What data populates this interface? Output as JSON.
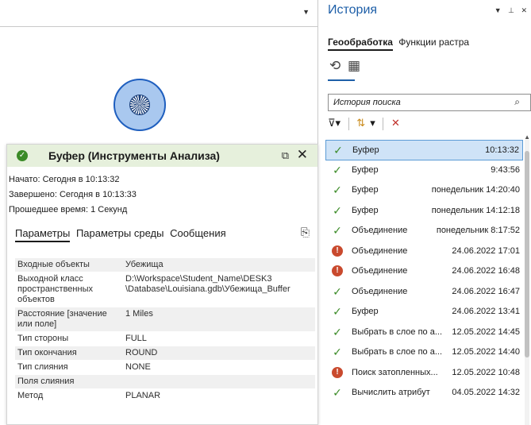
{
  "pane": {
    "title": "История",
    "tabs": [
      "Геообработка",
      "Функции растра"
    ],
    "search_placeholder": "История поиска",
    "history": [
      {
        "name": "Буфер",
        "time": "10:13:32",
        "status": "ok",
        "selected": true
      },
      {
        "name": "Буфер",
        "time": "9:43:56",
        "status": "ok"
      },
      {
        "name": "Буфер",
        "time": "понедельник 14:20:40",
        "status": "ok"
      },
      {
        "name": "Буфер",
        "time": "понедельник 14:12:18",
        "status": "ok"
      },
      {
        "name": "Объединение",
        "time": "понедельник 8:17:52",
        "status": "ok"
      },
      {
        "name": "Объединение",
        "time": "24.06.2022 17:01",
        "status": "error"
      },
      {
        "name": "Объединение",
        "time": "24.06.2022 16:48",
        "status": "error"
      },
      {
        "name": "Объединение",
        "time": "24.06.2022 16:47",
        "status": "ok"
      },
      {
        "name": "Буфер",
        "time": "24.06.2022 13:41",
        "status": "ok"
      },
      {
        "name": "Выбрать в слое по а...",
        "time": "12.05.2022 14:45",
        "status": "ok"
      },
      {
        "name": "Выбрать в слое по а...",
        "time": "12.05.2022 14:40",
        "status": "ok"
      },
      {
        "name": "Поиск затопленных...",
        "time": "12.05.2022 10:48",
        "status": "error"
      },
      {
        "name": "Вычислить атрибут",
        "time": "04.05.2022 14:32",
        "status": "ok"
      }
    ]
  },
  "popup": {
    "title": "Буфер (Инструменты Анализа)",
    "started": "Начато: Сегодня в 10:13:32",
    "finished": "Завершено: Сегодня в 10:13:33",
    "elapsed": "Прошедшее время: 1 Секунд",
    "tabs": [
      "Параметры",
      "Параметры среды",
      "Сообщения"
    ],
    "params": [
      {
        "key": "Входные объекты",
        "value": "Убежища"
      },
      {
        "key": "Выходной класс пространственных объектов",
        "value": "D:\\Workspace\\Student_Name\\DESK3 \\Database\\Louisiana.gdb\\Убежища_Buffer"
      },
      {
        "key": "Расстояние [значение или поле]",
        "value": "1 Miles"
      },
      {
        "key": "Тип стороны",
        "value": "FULL"
      },
      {
        "key": "Тип окончания",
        "value": "ROUND"
      },
      {
        "key": "Тип слияния",
        "value": "NONE"
      },
      {
        "key": "Поля слияния",
        "value": ""
      },
      {
        "key": "Метод",
        "value": "PLANAR"
      }
    ]
  },
  "colors": {
    "accent": "#1e5fa8",
    "success": "#3b8b27",
    "error": "#c94a2e",
    "selection": "#cfe3f7"
  }
}
